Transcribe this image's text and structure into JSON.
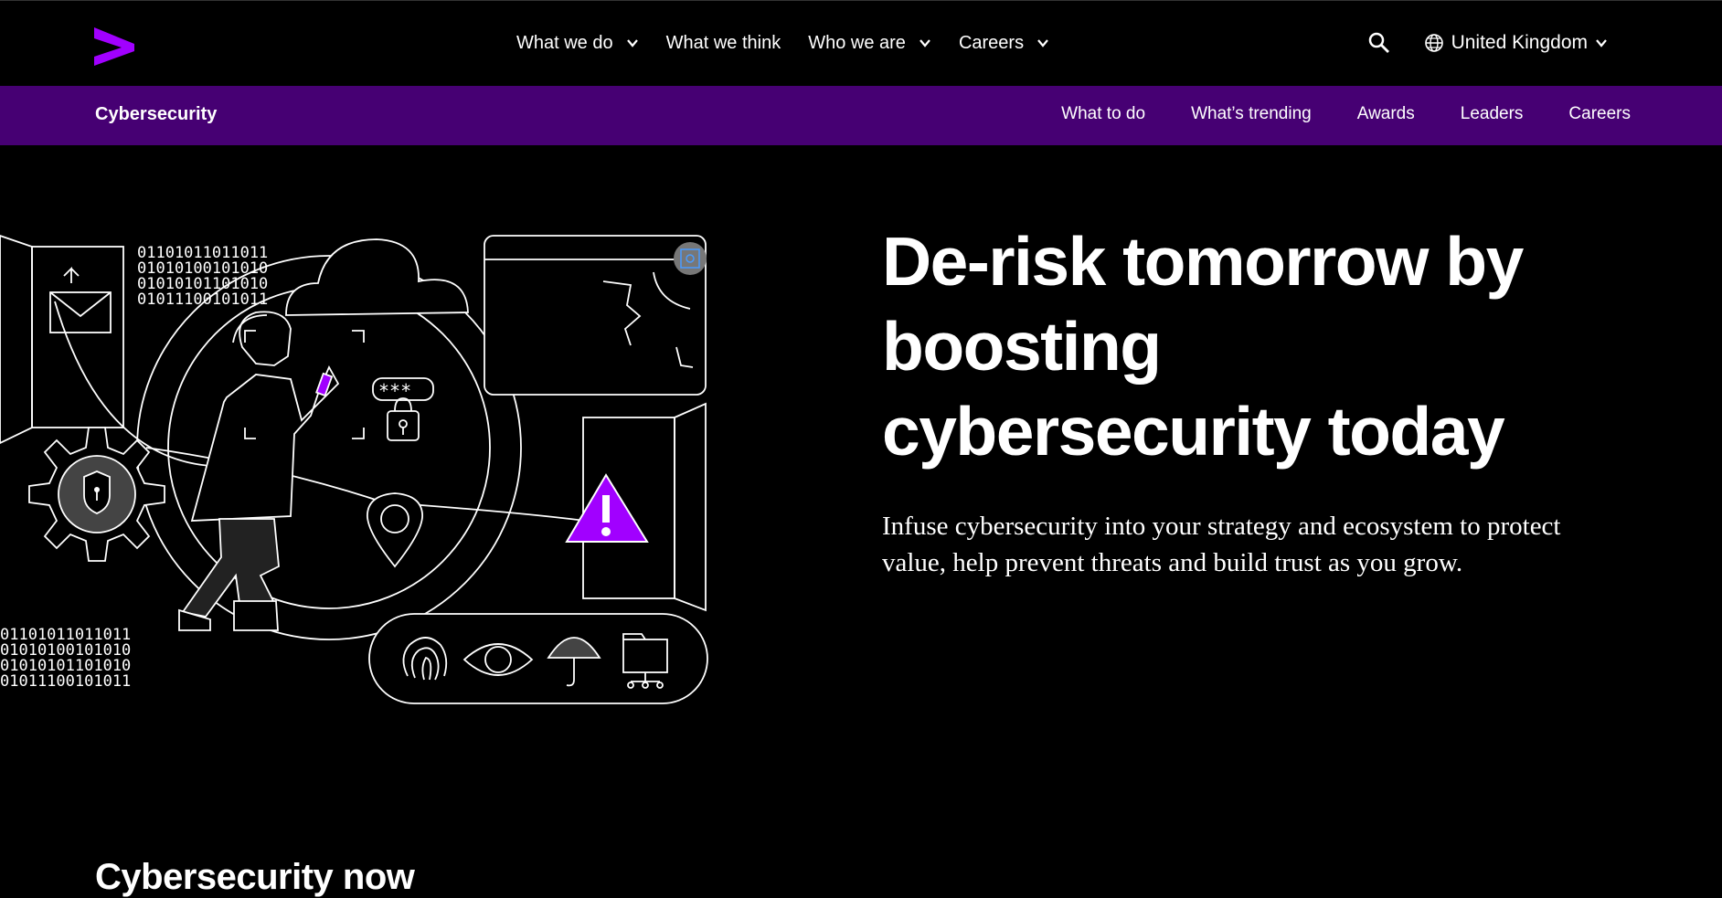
{
  "nav": {
    "items": [
      {
        "label": "What we do",
        "has_dropdown": true
      },
      {
        "label": "What we think",
        "has_dropdown": false
      },
      {
        "label": "Who we are",
        "has_dropdown": true
      },
      {
        "label": "Careers",
        "has_dropdown": true
      }
    ],
    "country": "United Kingdom",
    "icons": [
      "accenture-logo",
      "search-icon",
      "globe-icon",
      "chevron-down-icon"
    ]
  },
  "subnav": {
    "title": "Cybersecurity",
    "links": [
      "What to do",
      "What’s trending",
      "Awards",
      "Leaders",
      "Careers"
    ]
  },
  "hero": {
    "title": "De-risk tomorrow by boosting cybersecurity today",
    "subtitle": "Infuse cybersecurity into your strategy and ecosystem to protect value, help prevent threats and build trust as you grow.",
    "binary_text": [
      "01101011011011",
      "01010100101010",
      "01010101101010",
      "01011100101011"
    ]
  },
  "section": {
    "title": "Cybersecurity now"
  },
  "colors": {
    "accent": "#a100ff",
    "subnav_bg": "#460073",
    "background": "#000000",
    "text": "#ffffff"
  }
}
